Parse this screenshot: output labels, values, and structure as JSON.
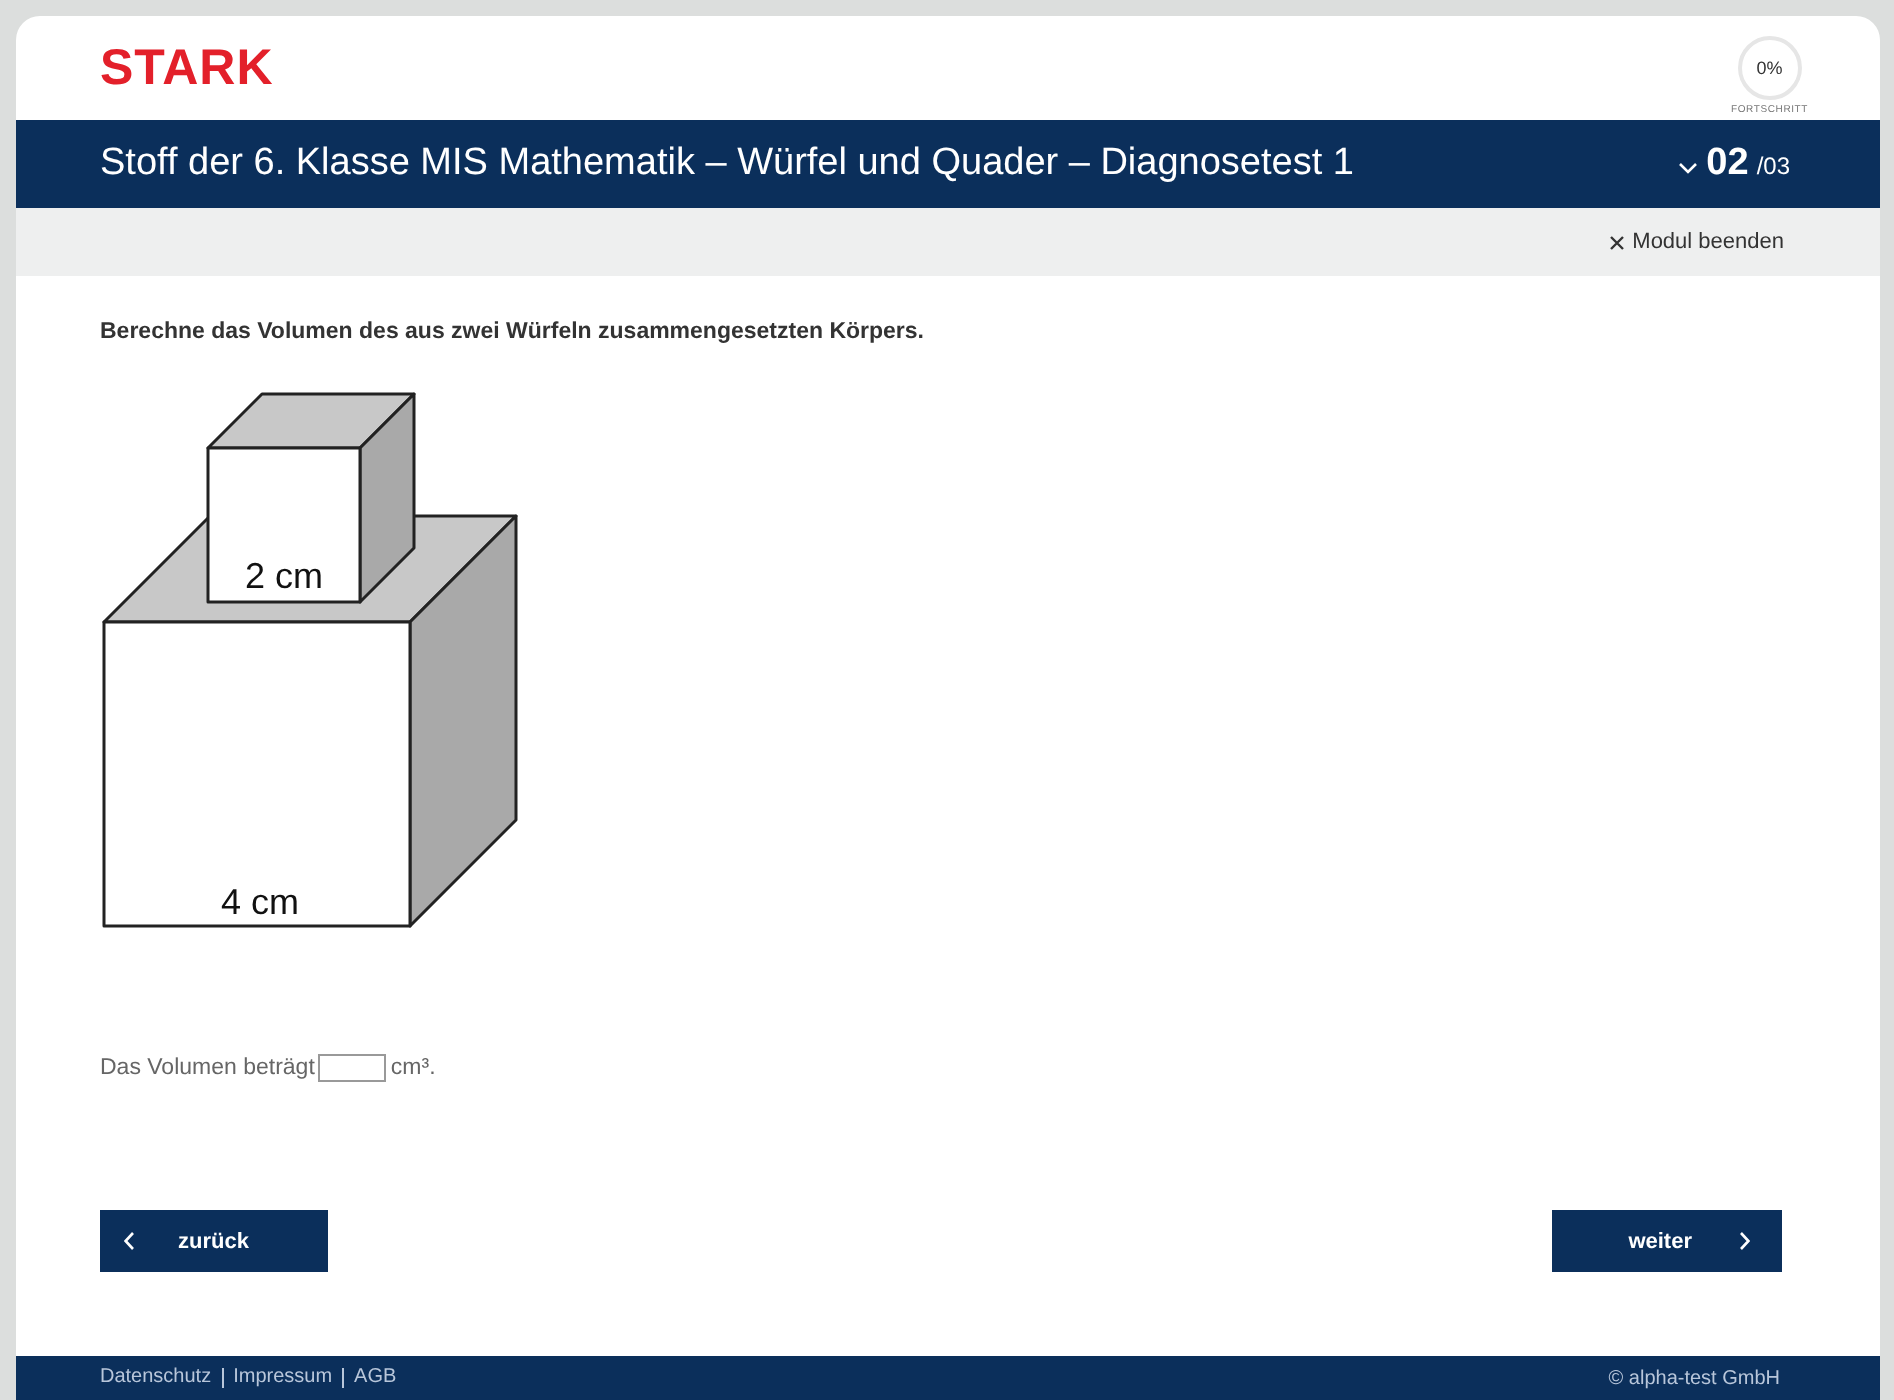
{
  "logo": "STARK",
  "progress": {
    "value": "0%",
    "label": "FORTSCHRITT"
  },
  "title": "Stoff der 6. Klasse MIS Mathematik – Würfel und Quader – Diagnosetest 1",
  "page": {
    "current": "02",
    "total": "/03"
  },
  "close": {
    "label": "Modul beenden"
  },
  "question": "Berechne das Volumen des aus zwei Würfeln zusammengesetzten Körpers.",
  "figure": {
    "small_label": "2 cm",
    "large_label": "4 cm"
  },
  "answer": {
    "before": "Das Volumen beträgt",
    "after": "cm³."
  },
  "buttons": {
    "back": "zurück",
    "next": "weiter"
  },
  "footer": {
    "links": [
      "Datenschutz",
      "Impressum",
      "AGB"
    ],
    "copyright": "© alpha-test GmbH"
  }
}
